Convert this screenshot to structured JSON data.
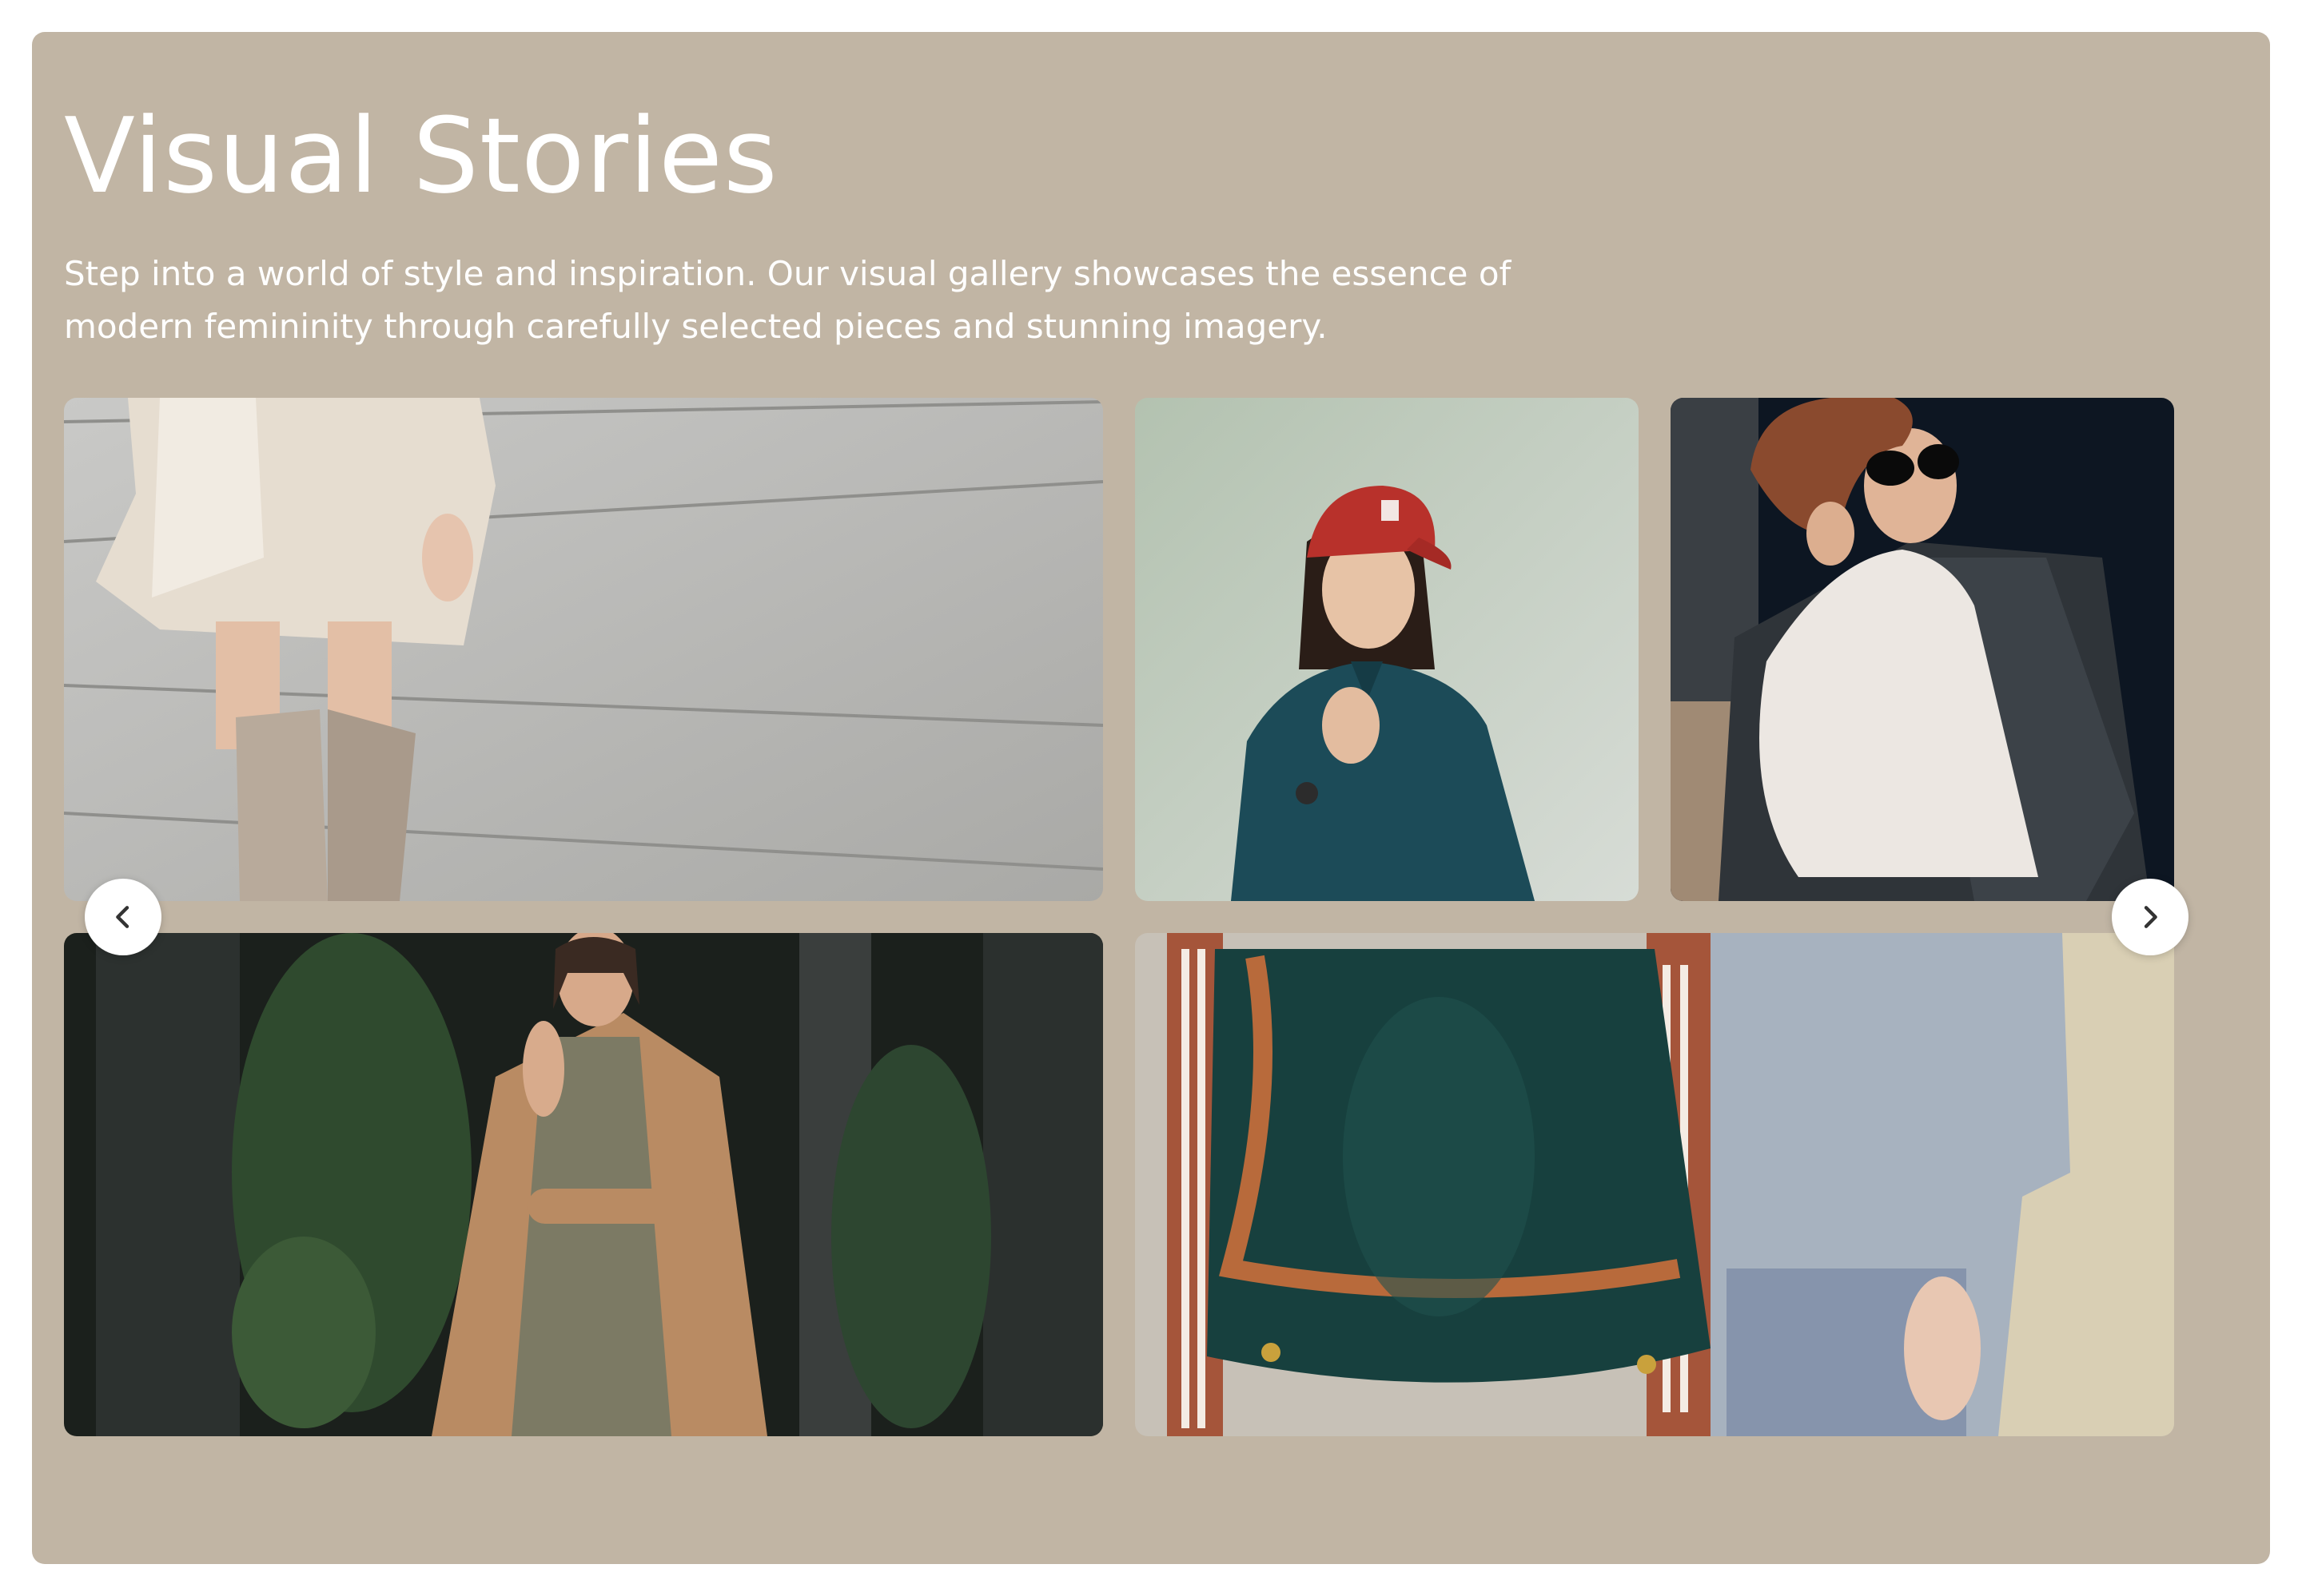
{
  "gallery": {
    "title": "Visual Stories",
    "description": "Step into a world of style and inspiration. Our visual gallery showcases the essence of modern femininity through carefully selected pieces and stunning imagery.",
    "background_color": "#c1b5a4",
    "nav": {
      "prev_icon": "chevron-left-icon",
      "next_icon": "chevron-right-icon"
    }
  }
}
